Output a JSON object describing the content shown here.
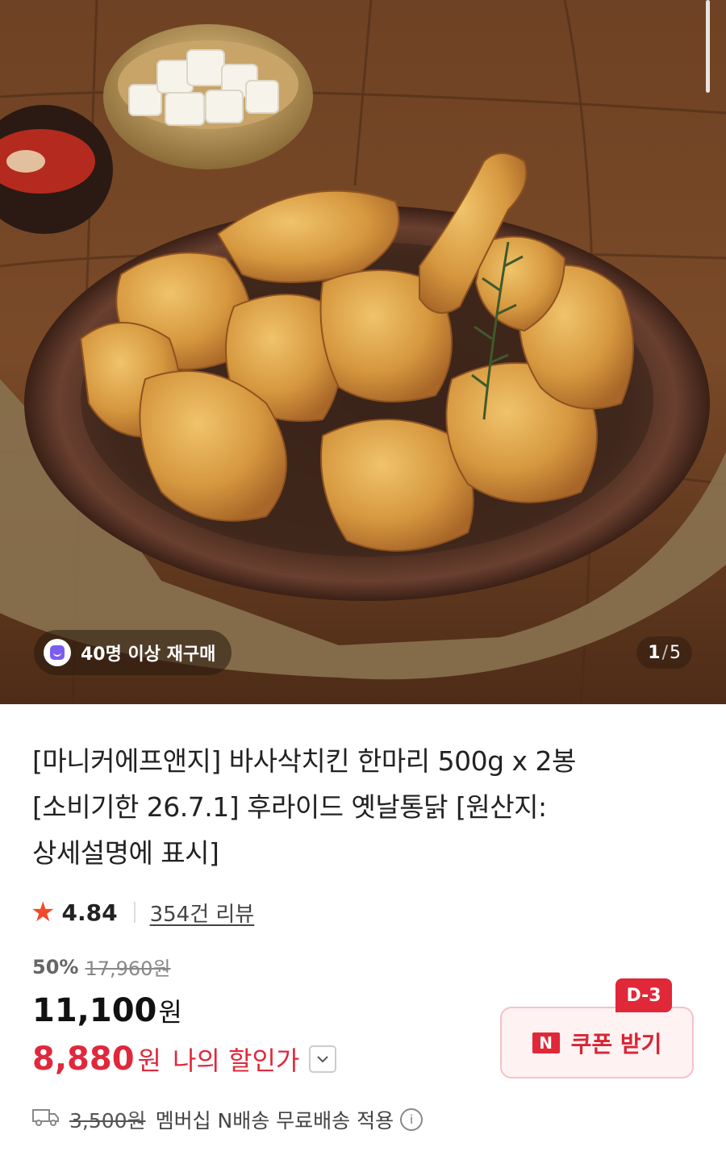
{
  "hero": {
    "badge_text": "40명 이상 재구매",
    "page_current": "1",
    "page_separator": "/",
    "page_total": "5"
  },
  "product": {
    "title_lines": [
      "[마니커에프앤지] 바사삭치킨 한마리 500g x 2봉",
      "[소비기한 26.7.1] 후라이드 옛날통닭 [원산지:",
      "상세설명에 표시]"
    ],
    "rating": "4.84",
    "review_count": "354건 리뷰",
    "discount_rate": "50%",
    "original_price": "17,960원",
    "sale_price": "11,100",
    "sale_price_unit": "원",
    "my_price": "8,880",
    "my_price_unit": "원",
    "my_price_label": "나의 할인가"
  },
  "coupon": {
    "dday": "D-3",
    "label": "쿠폰 받기",
    "brand_mark": "N"
  },
  "shipping": {
    "fee": "3,500원",
    "text": "멤버십 N배송 무료배송 적용"
  },
  "colors": {
    "accent": "#e0283c",
    "star": "#f04a2a",
    "badge_icon": "#7b5cf0"
  }
}
